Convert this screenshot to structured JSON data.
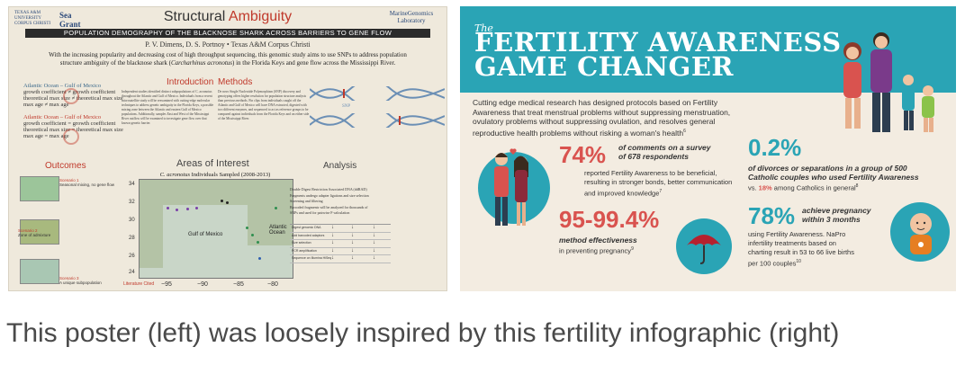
{
  "caption": "This poster (left) was loosely inspired by this fertility infographic (right)",
  "poster": {
    "logo_left_small": "TEXAS A&M UNIVERSITY CORPUS CHRISTI",
    "logo_left_big": "Sea Grant",
    "logo_right": "MarineGenomics Laboratory",
    "title_main": "Structural",
    "title_accent": "Ambiguity",
    "banner": "POPULATION DEMOGRAPHY OF THE BLACKNOSE SHARK ACROSS BARRIERS TO GENE FLOW",
    "authors": "P. V. Dimens, D. S. Portnoy  •  Texas A&M Corpus Christi",
    "abstract_1": "With the increasing popularity and decreasing cost of high throughput sequencing, this genomic study aims to use SNPs to address population",
    "abstract_2a": "structure ambiguity of the blacknose shark (",
    "abstract_species": "Carcharhinus acronotus",
    "abstract_2b": ") in the Florida Keys and gene flow across the Mississippi River.",
    "growth_blue": {
      "title": "Atlantic Ocean – Gulf of Mexico",
      "line1": "growth coefficient ≠ growth coefficient",
      "line2": "theoretical max size ≠ theoretical max size",
      "line3": "max age ≠ max age"
    },
    "growth_red": {
      "title": "Atlantic Ocean – Gulf of Mexico",
      "line1": "growth coefficient = growth coefficient",
      "line2": "theoretical max size = theoretical max size",
      "line3": "max age = max age"
    },
    "introduction_heading": "Introduction",
    "introduction_body": "Independent studies identified distinct subpopulations of C. acronotus throughout the Atlantic and Gulf of Mexico. Individuals from a recent microsatellite study will be reexamined with cutting-edge molecular techniques to address genetic ambiguity in the Florida Keys, a possible mixing zone between the Atlantic and eastern Gulf of Mexico populations. Additionally, samples East and West of the Mississippi River outflow will be examined to investigate gene flow over that known genetic barrier.",
    "methods_heading": "Methods",
    "methods_body": "De novo Single Nucleotide Polymorphism (SNP) discovery and genotyping offers higher resolution for population structure analysis than previous methods. Fin clips from individuals caught off the Atlantic and Gulf of Mexico will have DNA extracted, digested with two different enzymes, and sequenced to act as reference groups to be compared against individuals from the Florida Keys and on either side of the Mississippi River.",
    "snp_label": "SNP",
    "outcomes_heading": "Outcomes",
    "scenarios": [
      {
        "name": "Scenario 1",
        "desc": "Seasonal mixing, no gene flow"
      },
      {
        "name": "Scenario 2",
        "desc": "Zone of admixture"
      },
      {
        "name": "Scenario 3",
        "desc": "A unique subpopulation"
      }
    ],
    "areas_heading": "Areas of Interest",
    "areas_sub_species": "C. acronotus",
    "areas_sub_rest": " Individuals Sampled (2008-2013)",
    "map": {
      "x_ticks": [
        "−95",
        "−90",
        "−85",
        "−80"
      ],
      "y_ticks": [
        "34",
        "32",
        "30",
        "28",
        "26",
        "24"
      ],
      "gulf_label": "Gulf of Mexico",
      "atlantic_label": "Atlantic Ocean"
    },
    "analysis_heading": "Analysis",
    "analysis_list": [
      "Double Digest Restriction Associated DNA (ddRAD)",
      "Fragments undergo adapter ligations and size selection",
      "Screening and filtering",
      "Barcoded fragments will be analyzed for thousands of SNPs and used for pairwise F-calculation"
    ],
    "analysis_table": [
      "Digest genomic DNA",
      "Add barcoded adaptors",
      "Size selection",
      "PCR amplification",
      "Sequence on Illumina HiSeq"
    ],
    "literature_cited": "Literature Cited"
  },
  "infographic": {
    "the": "The",
    "title_line1": "FERTILITY AWARENESS",
    "title_line2": "GAME CHANGER",
    "intro": "Cutting edge medical research has designed protocols based on Fertility Awareness that treat menstrual problems without suppressing menstruation, ovulatory problems without suppressing ovulation, and resolves general reproductive health problems without risking a woman's health",
    "intro_ref": "6",
    "stat1": {
      "big": "74%",
      "italic_1": "of comments on a survey",
      "italic_2": "of 678 respondents",
      "text": "reported Fertility Awareness to be beneficial, resulting in stronger bonds, better communication and improved knowledge",
      "ref": "7"
    },
    "stat2": {
      "big": "0.2%",
      "italic_1": "of divorces or separations in a group of 500",
      "italic_2": "Catholic couples who used Fertility Awareness",
      "text_pre": "vs. ",
      "text_red": "18%",
      "text_post": " among Catholics in general",
      "ref": "8"
    },
    "stat3": {
      "big": "95-99.4%",
      "italic": "method effectiveness",
      "text": "in preventing pregnancy",
      "ref": "9"
    },
    "stat4": {
      "big": "78%",
      "italic_1": "achieve pregnancy",
      "italic_2": "within 3 months",
      "text": "using Fertility Awareness. NaPro infertility treatments based on charting result in 53 to 66 live births per 100 couples",
      "ref": "10"
    }
  },
  "colors": {
    "poster_accent": "#c0392b",
    "info_teal": "#2aa4b5",
    "info_red": "#d9534f"
  }
}
